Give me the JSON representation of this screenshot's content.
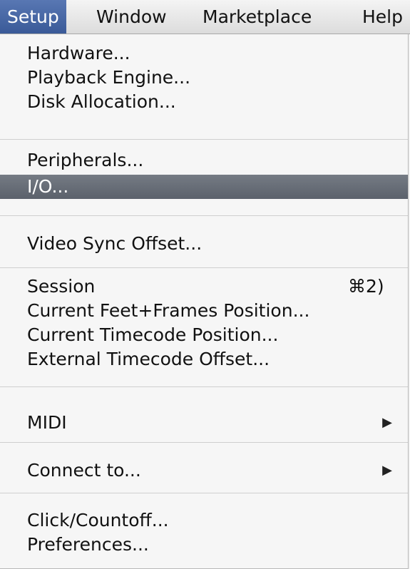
{
  "menubar": {
    "setup": "Setup",
    "window": "Window",
    "marketplace": "Marketplace",
    "help": "Help"
  },
  "menu": {
    "hardware": "Hardware...",
    "playback_engine": "Playback Engine...",
    "disk_allocation": "Disk Allocation...",
    "peripherals": "Peripherals...",
    "io": "I/O...",
    "video_sync_offset": "Video Sync Offset...",
    "session": "Session",
    "session_shortcut": "⌘2)",
    "current_feet_frames": "Current Feet+Frames Position...",
    "current_timecode": "Current Timecode Position...",
    "external_timecode_offset": "External Timecode Offset...",
    "midi": "MIDI",
    "connect_to": "Connect to...",
    "click_countoff": "Click/Countoff...",
    "preferences": "Preferences...",
    "submenu_arrow": "▶"
  },
  "colors": {
    "active_menu": "#3f5f9f",
    "highlight": "#646a73"
  }
}
